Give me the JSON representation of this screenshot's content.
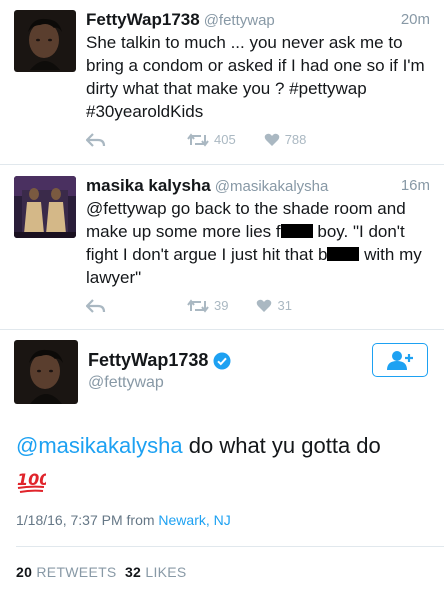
{
  "tweets": [
    {
      "display_name": "FettyWap1738",
      "handle": "@fettywap",
      "time": "20m",
      "text": "She talkin to much ... you never ask me to bring a condom or asked if I had one so if I'm dirty what that make you ? #pettywap #30yearoldKids",
      "retweets": "405",
      "likes": "788"
    },
    {
      "display_name": "masika kalysha",
      "handle": "@masikakalysha",
      "time": "16m",
      "text_part1": "@fettywap go back to the shade room and make up some more lies f",
      "text_part2": " boy. \"I don't fight I don't argue I just hit that b",
      "text_part3": " with my lawyer\"",
      "retweets": "39",
      "likes": "31"
    }
  ],
  "main_tweet": {
    "display_name": "FettyWap1738",
    "handle": "@fettywap",
    "mention": "@masikakalysha",
    "text": " do what yu gotta do",
    "emoji": "💯",
    "timestamp": "1/18/16, 7:37 PM from ",
    "location": "Newark, NJ",
    "retweets_count": "20",
    "retweets_label": "RETWEETS",
    "likes_count": "32",
    "likes_label": "LIKES"
  },
  "colors": {
    "accent": "#1da1f2",
    "muted": "#8899a6",
    "verified": "#1da1f2"
  }
}
